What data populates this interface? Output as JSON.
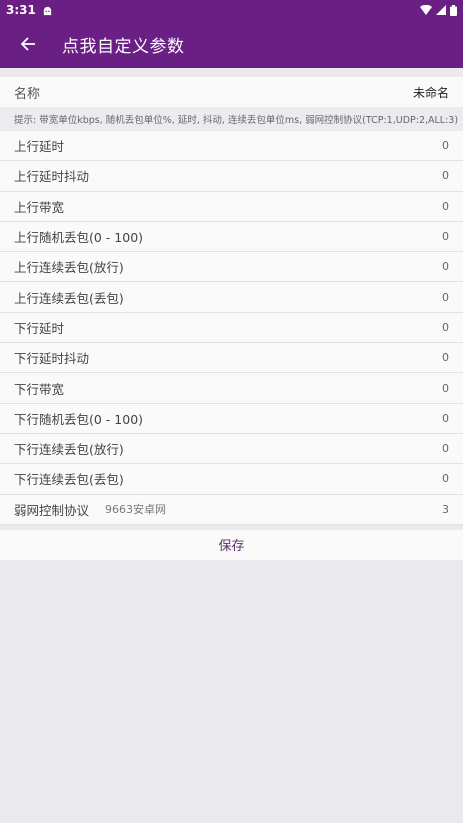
{
  "status_bar": {
    "time": "3:31"
  },
  "app_bar": {
    "title": "点我自定义参数"
  },
  "name_field": {
    "label": "名称",
    "value": "未命名"
  },
  "hint": "提示: 带宽单位kbps, 随机丢包单位%, 延时, 抖动, 连续丢包单位ms, 弱网控制协议(TCP:1,UDP:2,ALL:3)",
  "params": [
    {
      "label": "上行延时",
      "value": "0"
    },
    {
      "label": "上行延时抖动",
      "value": "0"
    },
    {
      "label": "上行带宽",
      "value": "0"
    },
    {
      "label": "上行随机丢包(0 - 100)",
      "value": "0"
    },
    {
      "label": "上行连续丢包(放行)",
      "value": "0"
    },
    {
      "label": "上行连续丢包(丢包)",
      "value": "0"
    },
    {
      "label": "下行延时",
      "value": "0"
    },
    {
      "label": "下行延时抖动",
      "value": "0"
    },
    {
      "label": "下行带宽",
      "value": "0"
    },
    {
      "label": "下行随机丢包(0 - 100)",
      "value": "0"
    },
    {
      "label": "下行连续丢包(放行)",
      "value": "0"
    },
    {
      "label": "下行连续丢包(丢包)",
      "value": "0"
    },
    {
      "label": "弱网控制协议",
      "value": "3"
    }
  ],
  "watermark": "9663安卓网",
  "save_label": "保存",
  "colors": {
    "primary": "#6a1f84",
    "save_text": "#5b2f6d",
    "background": "#e9e9ee"
  }
}
